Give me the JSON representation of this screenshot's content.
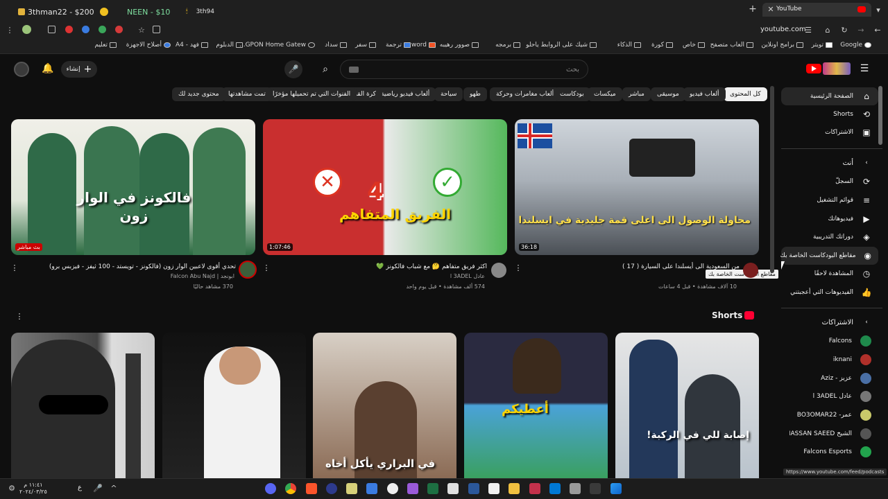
{
  "browser": {
    "extensions": [
      {
        "label": "3thman22 - $200"
      },
      {
        "label": "NEEN - $10"
      },
      {
        "label": "3th94"
      }
    ],
    "tab_title": "YouTube",
    "url": "youtube.com",
    "bookmarks": [
      "Google",
      "تويتر",
      "برامج اونلاين",
      "العاب متصفح",
      "خاص",
      "كورة",
      "الذكاء",
      "شيك على الروابط ياحلو",
      "برمجه",
      "صوور رهيبه",
      "word",
      "ترجمة",
      "سفر",
      "سداد",
      "GPON Home Gatew...",
      "الدبلوم",
      "فهد - A4",
      "أصلاح الاجهزة",
      "تعليم"
    ]
  },
  "masthead": {
    "create_label": "إنشاء",
    "search_placeholder": "بحث"
  },
  "chips": [
    "كل المحتوى",
    "ألعاب فيديو",
    "موسيقى",
    "مباشر",
    "ميكسات",
    "بودكاست",
    "ألعاب مغامرات وحركة",
    "طهو",
    "سياحة",
    "ألعاب فيديو رياضية",
    "كرة القدم",
    "الفنوات التي تم تحميلها مؤخرًا",
    "تمت مشاهدتها",
    "محتوى جديد لك"
  ],
  "sidebar": {
    "main": [
      {
        "label": "الصفحة الرئيسية",
        "icon": "home-icon"
      },
      {
        "label": "Shorts",
        "icon": "shorts-icon"
      },
      {
        "label": "الاشتراكات",
        "icon": "subscriptions-icon"
      }
    ],
    "you_header": "أنت",
    "you": [
      {
        "label": "السجلّ",
        "icon": "history-icon"
      },
      {
        "label": "قوائم التشغيل",
        "icon": "playlists-icon"
      },
      {
        "label": "فيديوهاتك",
        "icon": "your-videos-icon"
      },
      {
        "label": "دوراتك التدريبية",
        "icon": "courses-icon"
      },
      {
        "label": "مقاطع البودكاست الخاصة بك",
        "icon": "podcast-icon"
      },
      {
        "label": "المشاهدة لاحقًا",
        "icon": "watch-later-icon"
      },
      {
        "label": "الفيديوهات التي أعجبتني",
        "icon": "like-icon"
      }
    ],
    "tooltip": "مقاطع البودكاست الخاصة بك",
    "subs_header": "الاشتراكات",
    "subscriptions": [
      {
        "name": "Falcons",
        "color": "#1f8a4c"
      },
      {
        "name": "iknani",
        "color": "#b0302a"
      },
      {
        "name": "عزيز - Aziz",
        "color": "#4a6fa5"
      },
      {
        "name": "عادل l 3ADEL",
        "color": "#777777"
      },
      {
        "name": "عمر- BO3OMAR22",
        "color": "#c9c96a"
      },
      {
        "name": "الشيخ HASSAN SAEED",
        "color": "#555555"
      },
      {
        "name": "Falcons Esports",
        "color": "#22a34d"
      }
    ]
  },
  "videos": [
    {
      "title": "من السعودية الى أيسلندا على السيارة ( 17 )",
      "channel": "",
      "meta": "10 آلاف مشاهدة • قبل 4 ساعات",
      "duration": "36:18",
      "overlay": "محاولة الوصول الى اعلى قمة جليدية في ايسلندا"
    },
    {
      "title": "اكثر فريق متفاهم 🤔 مع شباب فالكونز 💚",
      "channel": "عادل l 3ADEL",
      "meta": "574 ألف مشاهدة • قبل يوم واحد",
      "duration": "1:07:46",
      "overlay": "الفريق المتفاهم"
    },
    {
      "title": "تحدي أقوى لاعبين الوار زون (فالكونز - تويستد - 100 ثيفز - فيزبس برو)",
      "channel": "ابونجد | Falcon Abu Najd",
      "meta": "370 مشاهد حاليًا",
      "duration": "بث مباشر",
      "overlay": "فالكونز في الوار زون"
    }
  ],
  "shorts": {
    "title": "Shorts",
    "items": [
      {
        "caption": "إصابة للي في الركبة!"
      },
      {
        "caption": "أعطيكم"
      },
      {
        "caption": "في البراري يأكل أخاه"
      },
      {
        "caption": ""
      },
      {
        "caption": ""
      }
    ]
  },
  "status_url": "https://www.youtube.com/feed/podcasts",
  "taskbar": {
    "time": "١١:٤١ م",
    "date": "٢٠٢٤/٠٣/٢٥",
    "lang": "ع"
  }
}
